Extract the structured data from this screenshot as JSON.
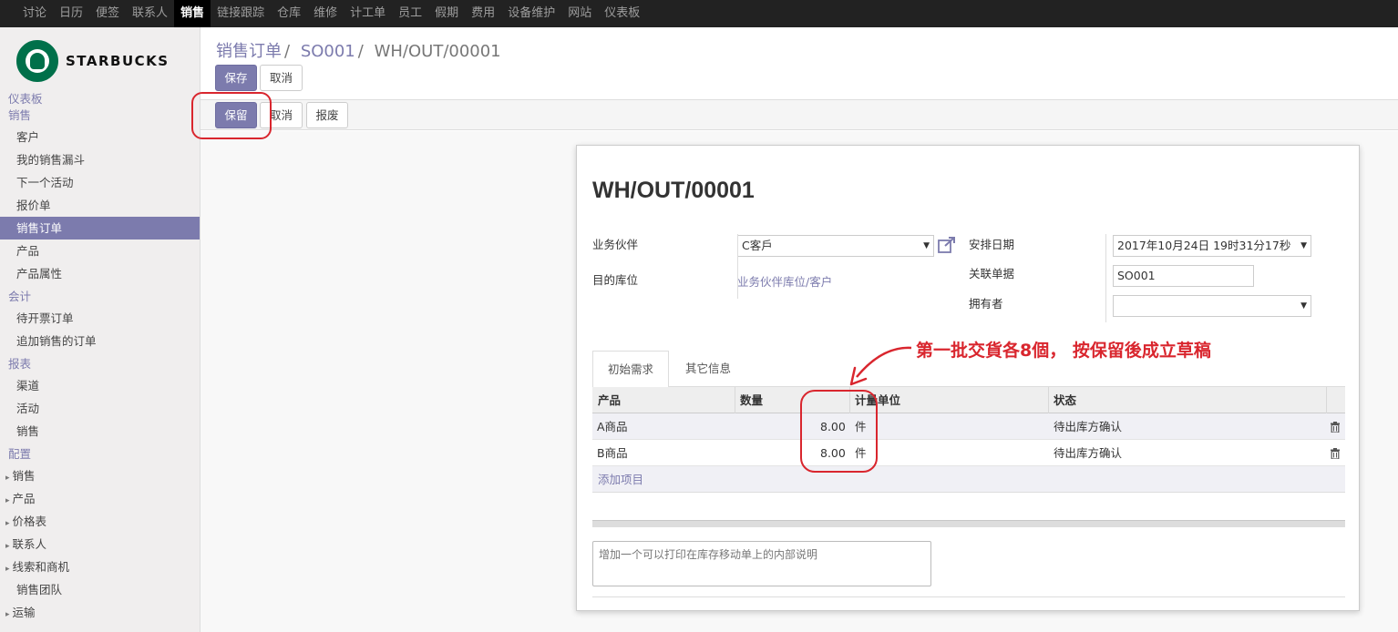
{
  "nav": {
    "items": [
      "讨论",
      "日历",
      "便签",
      "联系人",
      "销售",
      "链接跟踪",
      "仓库",
      "维修",
      "计工单",
      "员工",
      "假期",
      "费用",
      "设备维护",
      "网站",
      "仪表板"
    ],
    "active_index": 4
  },
  "logo": {
    "text": "STARBUCKS"
  },
  "sidebar": {
    "dashboard": "仪表板",
    "sales_head": "销售",
    "sales_items": [
      "客户",
      "我的销售漏斗",
      "下一个活动",
      "报价单",
      "销售订单",
      "产品",
      "产品属性"
    ],
    "active_item": "销售订单",
    "accounting_head": "会计",
    "accounting_items": [
      "待开票订单",
      "追加销售的订单"
    ],
    "reports_head": "报表",
    "reports_items": [
      "渠道",
      "活动",
      "销售"
    ],
    "config_head": "配置",
    "config_items": [
      "销售",
      "产品",
      "价格表",
      "联系人",
      "线索和商机",
      "销售团队",
      "运输"
    ]
  },
  "breadcrumb": {
    "level1": "销售订单",
    "level2": "SO001",
    "current": "WH/OUT/00001"
  },
  "buttons": {
    "save": "保存",
    "discard": "取消",
    "reserve": "保留",
    "cancel": "取消",
    "scrap": "报废"
  },
  "record": {
    "title": "WH/OUT/00001",
    "partner_label": "业务伙伴",
    "partner_value": "C客戶",
    "dest_label": "目的库位",
    "dest_value": "业务伙伴库位/客户",
    "scheduled_label": "安排日期",
    "scheduled_value": "2017年10月24日 19时31分17秒",
    "source_label": "关联单据",
    "source_value": "SO001",
    "owner_label": "拥有者",
    "owner_value": ""
  },
  "tabs": [
    "初始需求",
    "其它信息"
  ],
  "table": {
    "headers": [
      "产品",
      "数量",
      "计量单位",
      "状态"
    ],
    "rows": [
      {
        "product": "A商品",
        "qty": "8.00",
        "uom": "件",
        "state": "待出库方确认"
      },
      {
        "product": "B商品",
        "qty": "8.00",
        "uom": "件",
        "state": "待出库方确认"
      }
    ],
    "add_item": "添加项目"
  },
  "note_placeholder": "增加一个可以打印在库存移动单上的内部说明",
  "annotation": "第一批交貨各8個， 按保留後成立草稿",
  "colors": {
    "accent": "#7c7bad",
    "topbar": "#222222",
    "markup_red": "#d9262e",
    "brand_green": "#00704a"
  }
}
